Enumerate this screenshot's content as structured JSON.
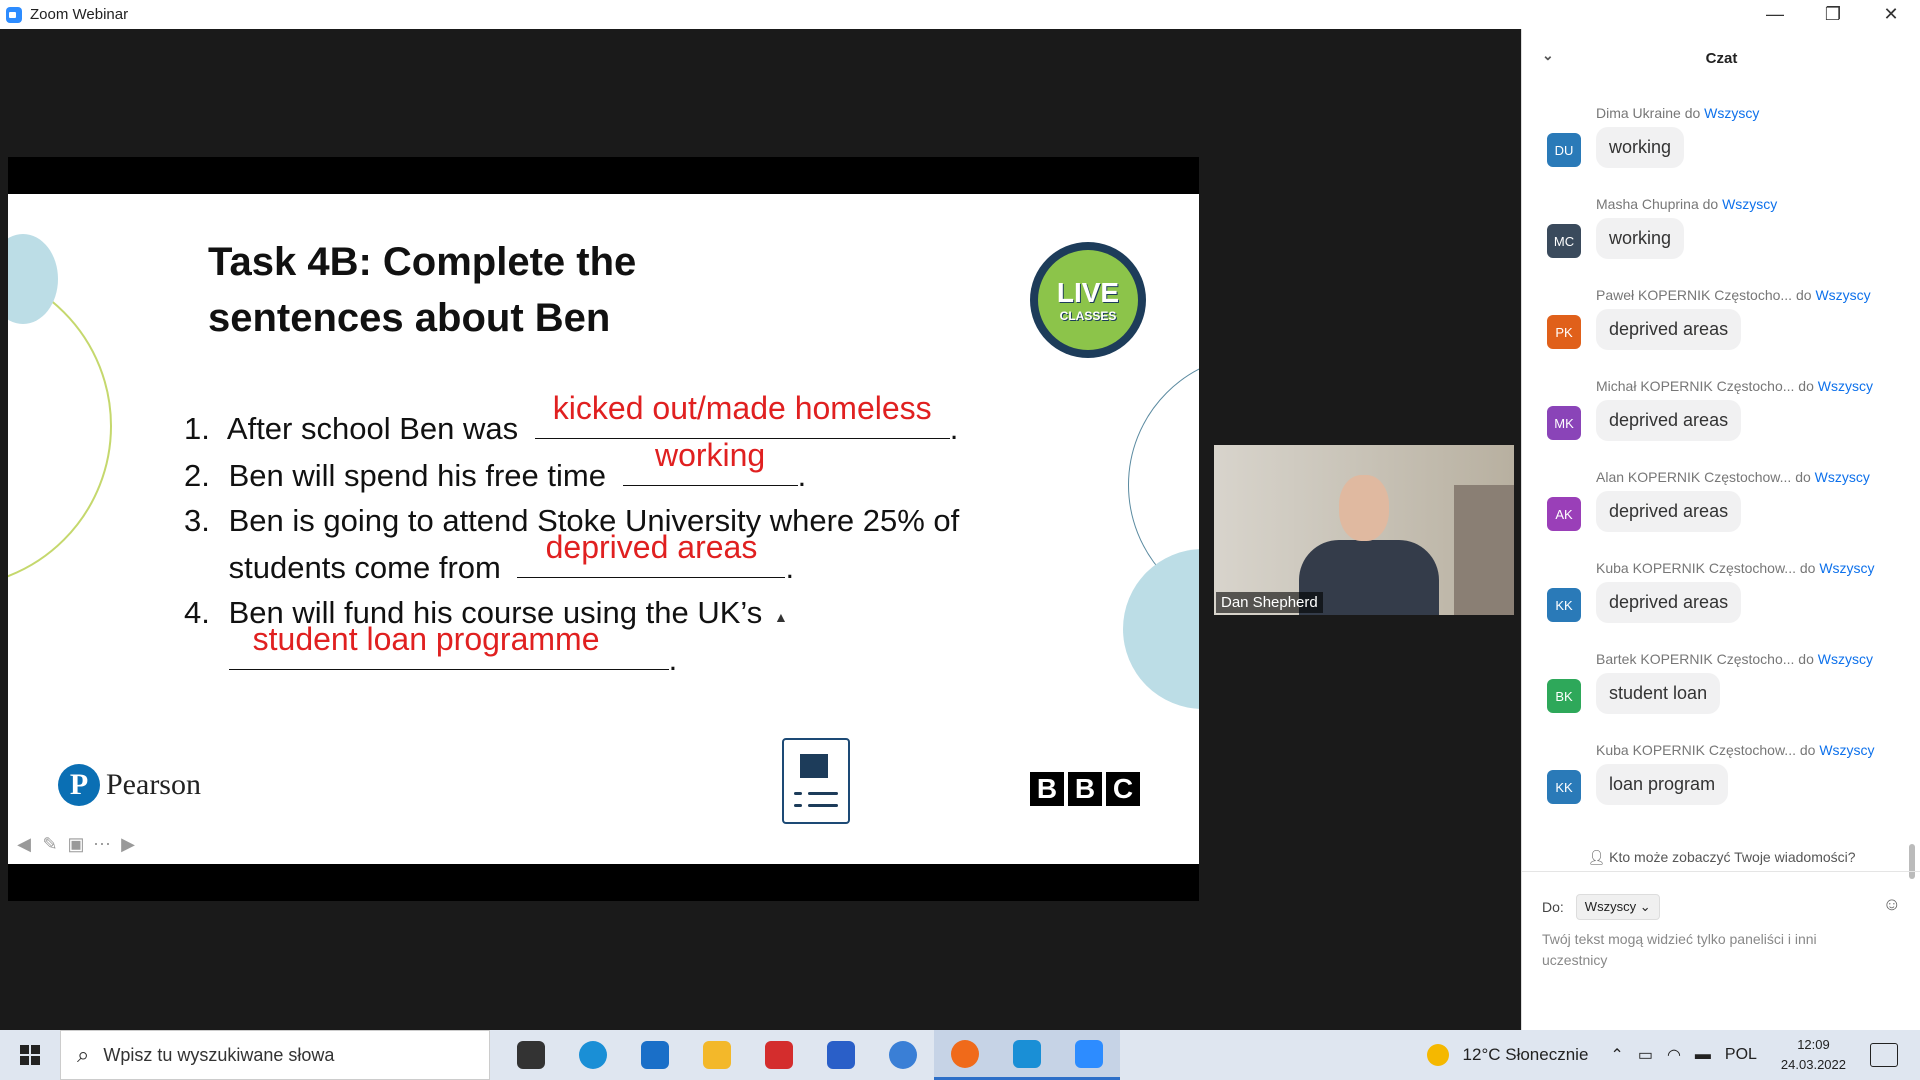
{
  "window": {
    "title": "Zoom Webinar",
    "controls": [
      "—",
      "❐",
      "✕"
    ]
  },
  "slide": {
    "title_line1": "Task 4B: Complete the",
    "title_line2": "sentences about Ben",
    "live_logo": {
      "line1": "LIVE",
      "line2": "CLASSES"
    },
    "items": [
      {
        "num": "1.",
        "text": "After school Ben was",
        "answer": "kicked out/made homeless",
        "after": "."
      },
      {
        "num": "2.",
        "text": "Ben will spend his free time",
        "answer": "working",
        "after": "."
      },
      {
        "num": "3.",
        "text": "Ben is going to attend Stoke University where 25% of",
        "answer": "",
        "after": ""
      },
      {
        "num": "",
        "text": "students come from",
        "answer": "deprived areas",
        "after": "."
      },
      {
        "num": "4.",
        "text": "Ben will fund his course using the UK’s",
        "answer": "",
        "after": ""
      },
      {
        "num": "",
        "text": "",
        "answer": "student loan programme",
        "after": "."
      }
    ],
    "pearson": "Pearson",
    "bbc": [
      "B",
      "B",
      "C"
    ]
  },
  "participant": {
    "name": "Dan Shepherd"
  },
  "chat": {
    "header": "Czat",
    "to_word": "do",
    "messages": [
      {
        "initials": "DU",
        "color": "#2a7ab8",
        "sender": "Dima Ukraine",
        "to": "Wszyscy",
        "text": "working"
      },
      {
        "initials": "MC",
        "color": "#3a4a5c",
        "sender": "Masha Chuprina",
        "to": "Wszyscy",
        "text": "working"
      },
      {
        "initials": "PK",
        "color": "#e0601a",
        "sender": "Paweł KOPERNIK Częstocho...",
        "to": "Wszyscy",
        "text": "deprived areas"
      },
      {
        "initials": "MK",
        "color": "#8a44b8",
        "sender": "Michał KOPERNIK Częstocho...",
        "to": "Wszyscy",
        "text": "deprived areas"
      },
      {
        "initials": "AK",
        "color": "#9a3fb8",
        "sender": "Alan KOPERNIK Częstochow...",
        "to": "Wszyscy",
        "text": "deprived areas"
      },
      {
        "initials": "KK",
        "color": "#2a7ab8",
        "sender": "Kuba KOPERNIK Częstochow...",
        "to": "Wszyscy",
        "text": "deprived areas"
      },
      {
        "initials": "BK",
        "color": "#2ea85a",
        "sender": "Bartek KOPERNIK Częstocho...",
        "to": "Wszyscy",
        "text": "student loan"
      },
      {
        "initials": "KK",
        "color": "#2a7ab8",
        "sender": "Kuba KOPERNIK Częstochow...",
        "to": "Wszyscy",
        "text": "loan program"
      }
    ],
    "privacy": "Kto może zobaczyć Twoje wiadomości?",
    "to_label": "Do:",
    "to_select": "Wszyscy",
    "placeholder": "Twój tekst mogą widzieć tylko paneliści i inni uczestnicy"
  },
  "taskbar": {
    "search_placeholder": "Wpisz tu wyszukiwane słowa",
    "apps": [
      {
        "name": "task-view",
        "color": "#333"
      },
      {
        "name": "edge",
        "color": "#1a8fd6"
      },
      {
        "name": "mail",
        "color": "#1a6fc8"
      },
      {
        "name": "file-explorer",
        "color": "#f3b82a"
      },
      {
        "name": "gift-app",
        "color": "#d42d2d"
      },
      {
        "name": "store",
        "color": "#2a5fc8"
      },
      {
        "name": "chrome",
        "color": "#3a7fd6"
      },
      {
        "name": "firefox",
        "color": "#f06a1a"
      },
      {
        "name": "camera-app",
        "color": "#1a8fd6"
      },
      {
        "name": "zoom",
        "color": "#2d8cff"
      }
    ],
    "weather": "12°C  Słonecznie",
    "lang": "POL",
    "time": "12:09",
    "date": "24.03.2022"
  }
}
